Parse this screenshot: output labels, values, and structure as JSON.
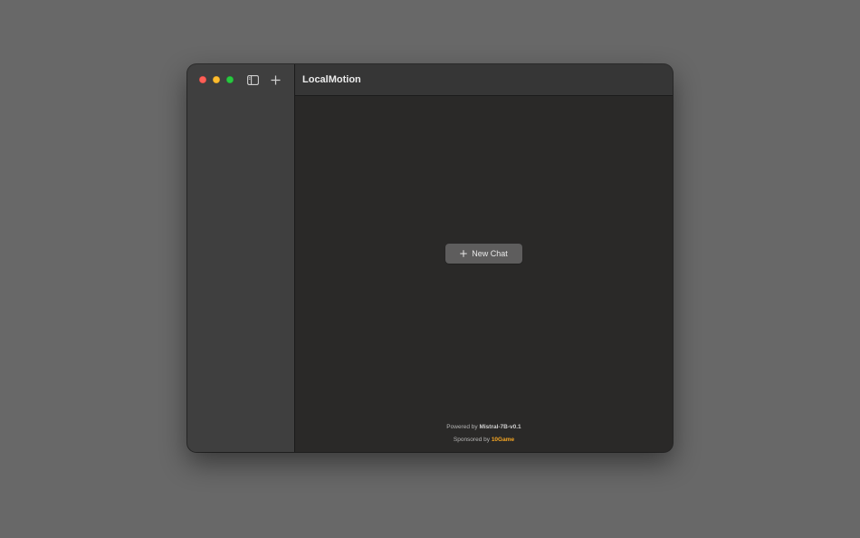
{
  "window": {
    "title": "LocalMotion"
  },
  "toolbar": {
    "sidebar_toggle_icon": "sidebar-toggle-icon",
    "new_chat_icon": "plus-icon"
  },
  "main": {
    "new_chat_label": "New Chat",
    "powered_prefix": "Powered by",
    "model_name": "Mistral-7B-v0.1",
    "sponsored_prefix": "Sponsored by",
    "sponsor_name": "10Game"
  },
  "colors": {
    "desktop": "#686868",
    "sidebar": "#3f3f3f",
    "content": "#2a2928",
    "accent": "#f5a623",
    "close": "#ff5f57",
    "minimize": "#febc2e",
    "zoom": "#28c840"
  }
}
